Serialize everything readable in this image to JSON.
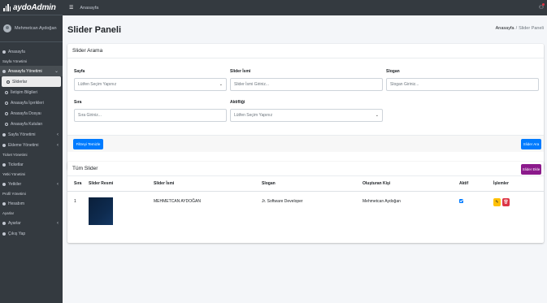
{
  "brand": {
    "name": "aydoAdmin"
  },
  "user": {
    "name": "Mehmetcan Aydoğan"
  },
  "topbar": {
    "breadcrumb_home": "Anasayfa"
  },
  "sidebar": {
    "items": [
      {
        "type": "item",
        "label": "Anasayfa",
        "icon": "dashboard-icon"
      },
      {
        "type": "header",
        "label": "Sayfa Yönetimi"
      },
      {
        "type": "item",
        "label": "Anasayfa Yönetimi",
        "icon": "home-icon",
        "open": true,
        "arrow": "⌄"
      },
      {
        "type": "sub",
        "label": "Sliderlar",
        "active": true
      },
      {
        "type": "sub",
        "label": "İletişim Bilgileri"
      },
      {
        "type": "sub",
        "label": "Anasayfa İçerikleri"
      },
      {
        "type": "sub",
        "label": "Anasayfa Dosyaı"
      },
      {
        "type": "sub",
        "label": "Anasayfa Kutuları"
      },
      {
        "type": "item",
        "label": "Sayfa Yönetimi",
        "icon": "file-icon",
        "arrow": "‹"
      },
      {
        "type": "item",
        "label": "Ekleme Yönetimi",
        "icon": "plus-icon",
        "arrow": "‹"
      },
      {
        "type": "header",
        "label": "Ticket Yönetimi"
      },
      {
        "type": "item",
        "label": "Ticketlar",
        "icon": "ticket-icon"
      },
      {
        "type": "header",
        "label": "Yetki Yönetimi"
      },
      {
        "type": "item",
        "label": "Yetkiler",
        "icon": "lock-icon",
        "arrow": "‹"
      },
      {
        "type": "header",
        "label": "Profil Yönetimi"
      },
      {
        "type": "item",
        "label": "Hesabım",
        "icon": "user-icon"
      },
      {
        "type": "header",
        "label": "Ayarlar"
      },
      {
        "type": "item",
        "label": "Ayarlar",
        "icon": "gear-icon",
        "arrow": "‹"
      },
      {
        "type": "item",
        "label": "Çıkış Yap",
        "icon": "logout-icon"
      }
    ]
  },
  "page": {
    "title": "Slider Paneli",
    "breadcrumb": {
      "home": "Anasayfa",
      "sep": "/",
      "current": "Slider Paneli"
    }
  },
  "search": {
    "title": "Slider Arama",
    "fields": {
      "sayfa": {
        "label": "Sayfa",
        "value": "Lütfen Seçim Yapınız"
      },
      "slider_ismi": {
        "label": "Slider İsmi",
        "placeholder": "Slider İsmi Giriniz..."
      },
      "slogan": {
        "label": "Slogan",
        "placeholder": "Slogan Giriniz..."
      },
      "sira": {
        "label": "Sıra",
        "placeholder": "Sıra Giriniz..."
      },
      "aktiflik": {
        "label": "Aktifliği",
        "value": "Lütfen Seçim Yapınız"
      }
    },
    "reset_button": "Filtreyi Temizle",
    "search_button": "Slider Ara"
  },
  "table": {
    "title": "Tüm Slider",
    "add_button": "Slider Ekle",
    "columns": [
      "Sıra",
      "Slider Resmi",
      "Slider İsmi",
      "Slogan",
      "Oluşturan Kişi",
      "Aktif",
      "İşlemler"
    ],
    "rows": [
      {
        "sira": "1",
        "isim": "MEHMETCAN AYDOĞAN",
        "slogan": "Jr. Software Developer",
        "olusturan": "Mehmetcan Aydoğan",
        "aktif": true
      }
    ]
  },
  "colors": {
    "primary": "#007bff",
    "purple": "#8b1a8b",
    "warning": "#ffc107",
    "danger": "#dc3545",
    "sidebar": "#343a40"
  }
}
